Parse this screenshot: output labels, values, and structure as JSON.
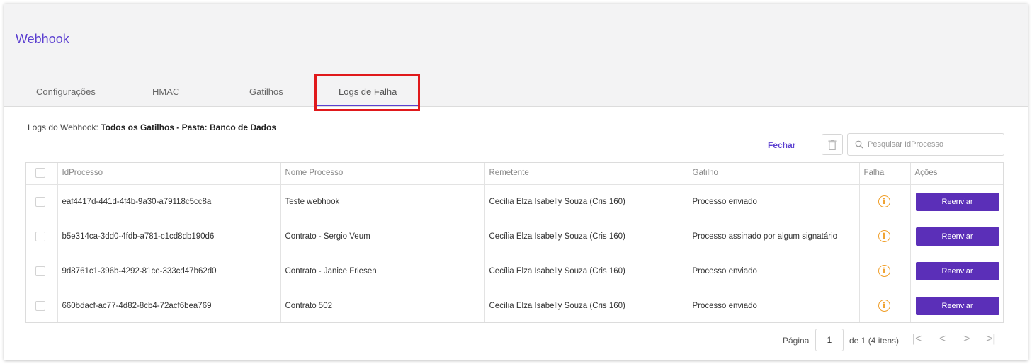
{
  "header": {
    "title": "Webhook"
  },
  "tabs": [
    {
      "label": "Configurações"
    },
    {
      "label": "HMAC"
    },
    {
      "label": "Gatilhos"
    },
    {
      "label": "Logs de Falha",
      "active": true
    }
  ],
  "logs": {
    "prefix": "Logs do Webhook: ",
    "context": "Todos os Gatilhos - Pasta: Banco de Dados",
    "close_label": "Fechar",
    "search_placeholder": "Pesquisar IdProcesso"
  },
  "table": {
    "columns": [
      "IdProcesso",
      "Nome Processo",
      "Remetente",
      "Gatilho",
      "Falha",
      "Ações"
    ],
    "action_label": "Reenviar",
    "rows": [
      {
        "id": "eaf4417d-441d-4f4b-9a30-a79118c5cc8a",
        "nome": "Teste webhook",
        "remetente": "Cecília Elza Isabelly Souza (Cris 160)",
        "gatilho": "Processo enviado"
      },
      {
        "id": "b5e314ca-3dd0-4fdb-a781-c1cd8db190d6",
        "nome": "Contrato - Sergio Veum",
        "remetente": "Cecília Elza Isabelly Souza (Cris 160)",
        "gatilho": "Processo assinado por algum signatário"
      },
      {
        "id": "9d8761c1-396b-4292-81ce-333cd47b62d0",
        "nome": "Contrato - Janice Friesen",
        "remetente": "Cecília Elza Isabelly Souza (Cris 160)",
        "gatilho": "Processo enviado"
      },
      {
        "id": "660bdacf-ac77-4d82-8cb4-72acf6bea769",
        "nome": "Contrato 502",
        "remetente": "Cecília Elza Isabelly Souza (Cris 160)",
        "gatilho": "Processo enviado"
      }
    ]
  },
  "pagination": {
    "page_label": "Página",
    "current_page": "1",
    "of_text": "de 1 (4 itens)"
  },
  "colors": {
    "accent": "#5b3fd0",
    "button": "#5b2fb8",
    "warning": "#f0a02c",
    "highlight": "#e0191b"
  },
  "icons": [
    "trash-icon",
    "search-icon",
    "info-icon",
    "first-page-icon",
    "prev-page-icon",
    "next-page-icon",
    "last-page-icon"
  ]
}
